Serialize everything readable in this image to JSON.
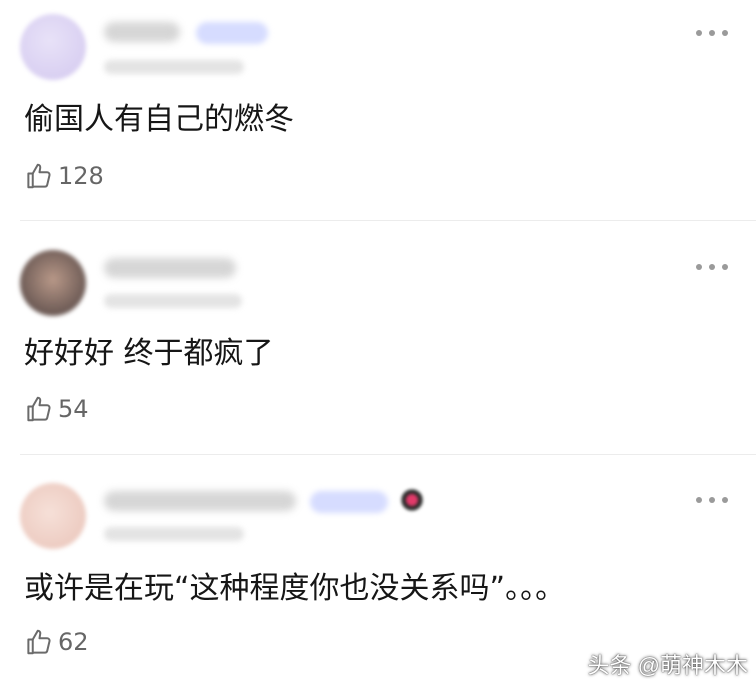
{
  "comments": [
    {
      "text": "偷国人有自己的燃冬",
      "likes": "128",
      "avatar_color": "#ded6f2"
    },
    {
      "text": "好好好 终于都疯了",
      "likes": "54",
      "avatar_color": "#c7b3a6"
    },
    {
      "text": "或许是在玩“这种程度你也没关系吗”。。。",
      "likes": "62",
      "avatar_color": "#f0d4cc"
    }
  ],
  "watermark": "头条 @萌神木木",
  "icons": {
    "like": "thumbs-up-icon",
    "more": "more-dots-icon"
  },
  "colors": {
    "tag_blue": "#d6dcff",
    "divider": "#ececec",
    "text_gray": "#666666"
  }
}
